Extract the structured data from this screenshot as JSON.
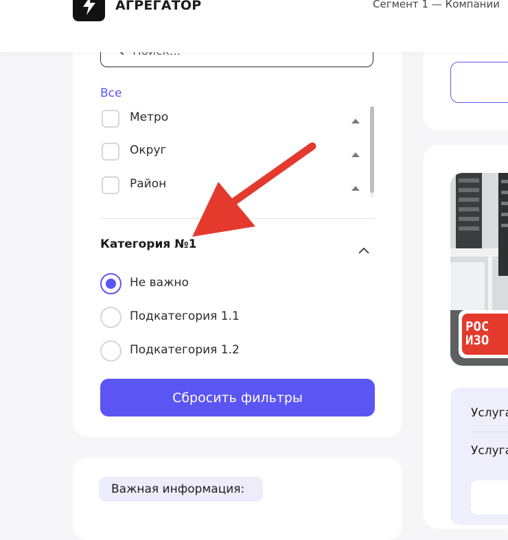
{
  "header": {
    "logo_title": "АГРЕГАТОР",
    "segment_text": "Сегмент 1 — Компании"
  },
  "filters": {
    "search_placeholder": "Поиск...",
    "all_link": "Все",
    "checkbox_items": [
      {
        "label": "Метро"
      },
      {
        "label": "Округ"
      },
      {
        "label": "Район"
      }
    ],
    "category": {
      "title": "Категория №1",
      "options": [
        {
          "label": "Не важно",
          "selected": true
        },
        {
          "label": "Подкатегория 1.1",
          "selected": false
        },
        {
          "label": "Подкатегория 1.2",
          "selected": false
        }
      ]
    },
    "reset_label": "Сбросить фильтры"
  },
  "info": {
    "badge_label": "Важная информация:"
  },
  "right_panel": {
    "logo_badge_text": [
      "РОС",
      "ИЗО"
    ],
    "services": [
      "Услуга",
      "Услуга"
    ]
  },
  "colors": {
    "accent": "#5b55f3",
    "arrow": "#e43a2e",
    "badge_red": "#e43a2e"
  },
  "icons": {
    "logo": "lightning-icon",
    "search": "search-icon",
    "expand": "chevron-up-icon",
    "sort": "triangle-up-icon",
    "annotation": "arrow-icon"
  }
}
